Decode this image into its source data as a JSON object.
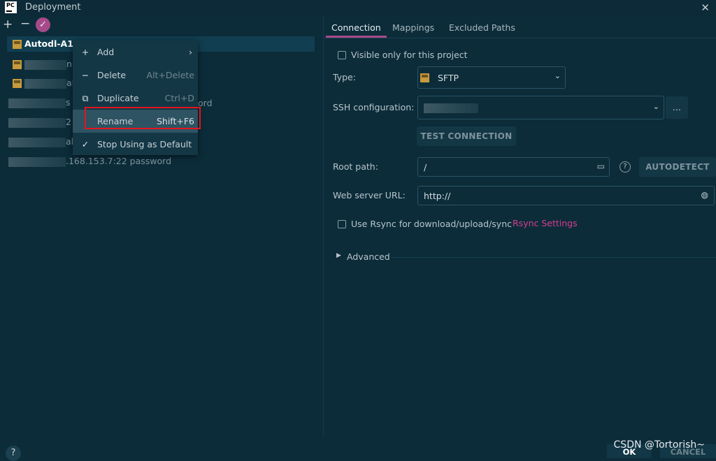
{
  "window": {
    "title": "Deployment",
    "logo_text": "PC"
  },
  "toolbar": {
    "add": "+",
    "remove": "−",
    "default": "✓"
  },
  "servers": [
    {
      "name": "Autodl-A10",
      "selected": true
    },
    {
      "name": "n"
    },
    {
      "name": "al"
    },
    {
      "name": "s"
    },
    {
      "name": "2"
    },
    {
      "name": "al"
    },
    {
      "name": ".168.153.7:22 password"
    }
  ],
  "behind_menu_text": "ord",
  "context_menu": {
    "items": [
      {
        "icon": "+",
        "label": "Add",
        "shortcut": ""
      },
      {
        "icon": "−",
        "label": "Delete",
        "shortcut": "Alt+Delete"
      },
      {
        "icon": "⧉",
        "label": "Duplicate",
        "shortcut": "Ctrl+D"
      },
      {
        "icon": "",
        "label": "Rename",
        "shortcut": "Shift+F6"
      },
      {
        "icon": "✓",
        "label": "Stop Using as Default",
        "shortcut": ""
      }
    ]
  },
  "tabs": [
    {
      "label": "Connection",
      "active": true
    },
    {
      "label": "Mappings"
    },
    {
      "label": "Excluded Paths"
    }
  ],
  "form": {
    "visible_only_label": "Visible only for this project",
    "type_label": "Type:",
    "type_value": "SFTP",
    "ssh_label": "SSH configuration:",
    "ssh_more": "...",
    "test_connection": "TEST CONNECTION",
    "root_label": "Root path:",
    "root_value": "/",
    "autodetect": "AUTODETECT",
    "help": "?",
    "web_label": "Web server URL:",
    "web_value": "http://",
    "rsync_label": "Use Rsync for download/upload/sync",
    "rsync_link": "Rsync Settings",
    "advanced": "Advanced"
  },
  "footer": {
    "help": "?",
    "ok": "OK",
    "cancel": "CANCEL",
    "watermark": "CSDN @Tortorish~"
  },
  "colors": {
    "accent": "#a64a8a",
    "link": "#d63d8f",
    "highlight_box": "#e3161e",
    "background": "#0c2c3a"
  }
}
